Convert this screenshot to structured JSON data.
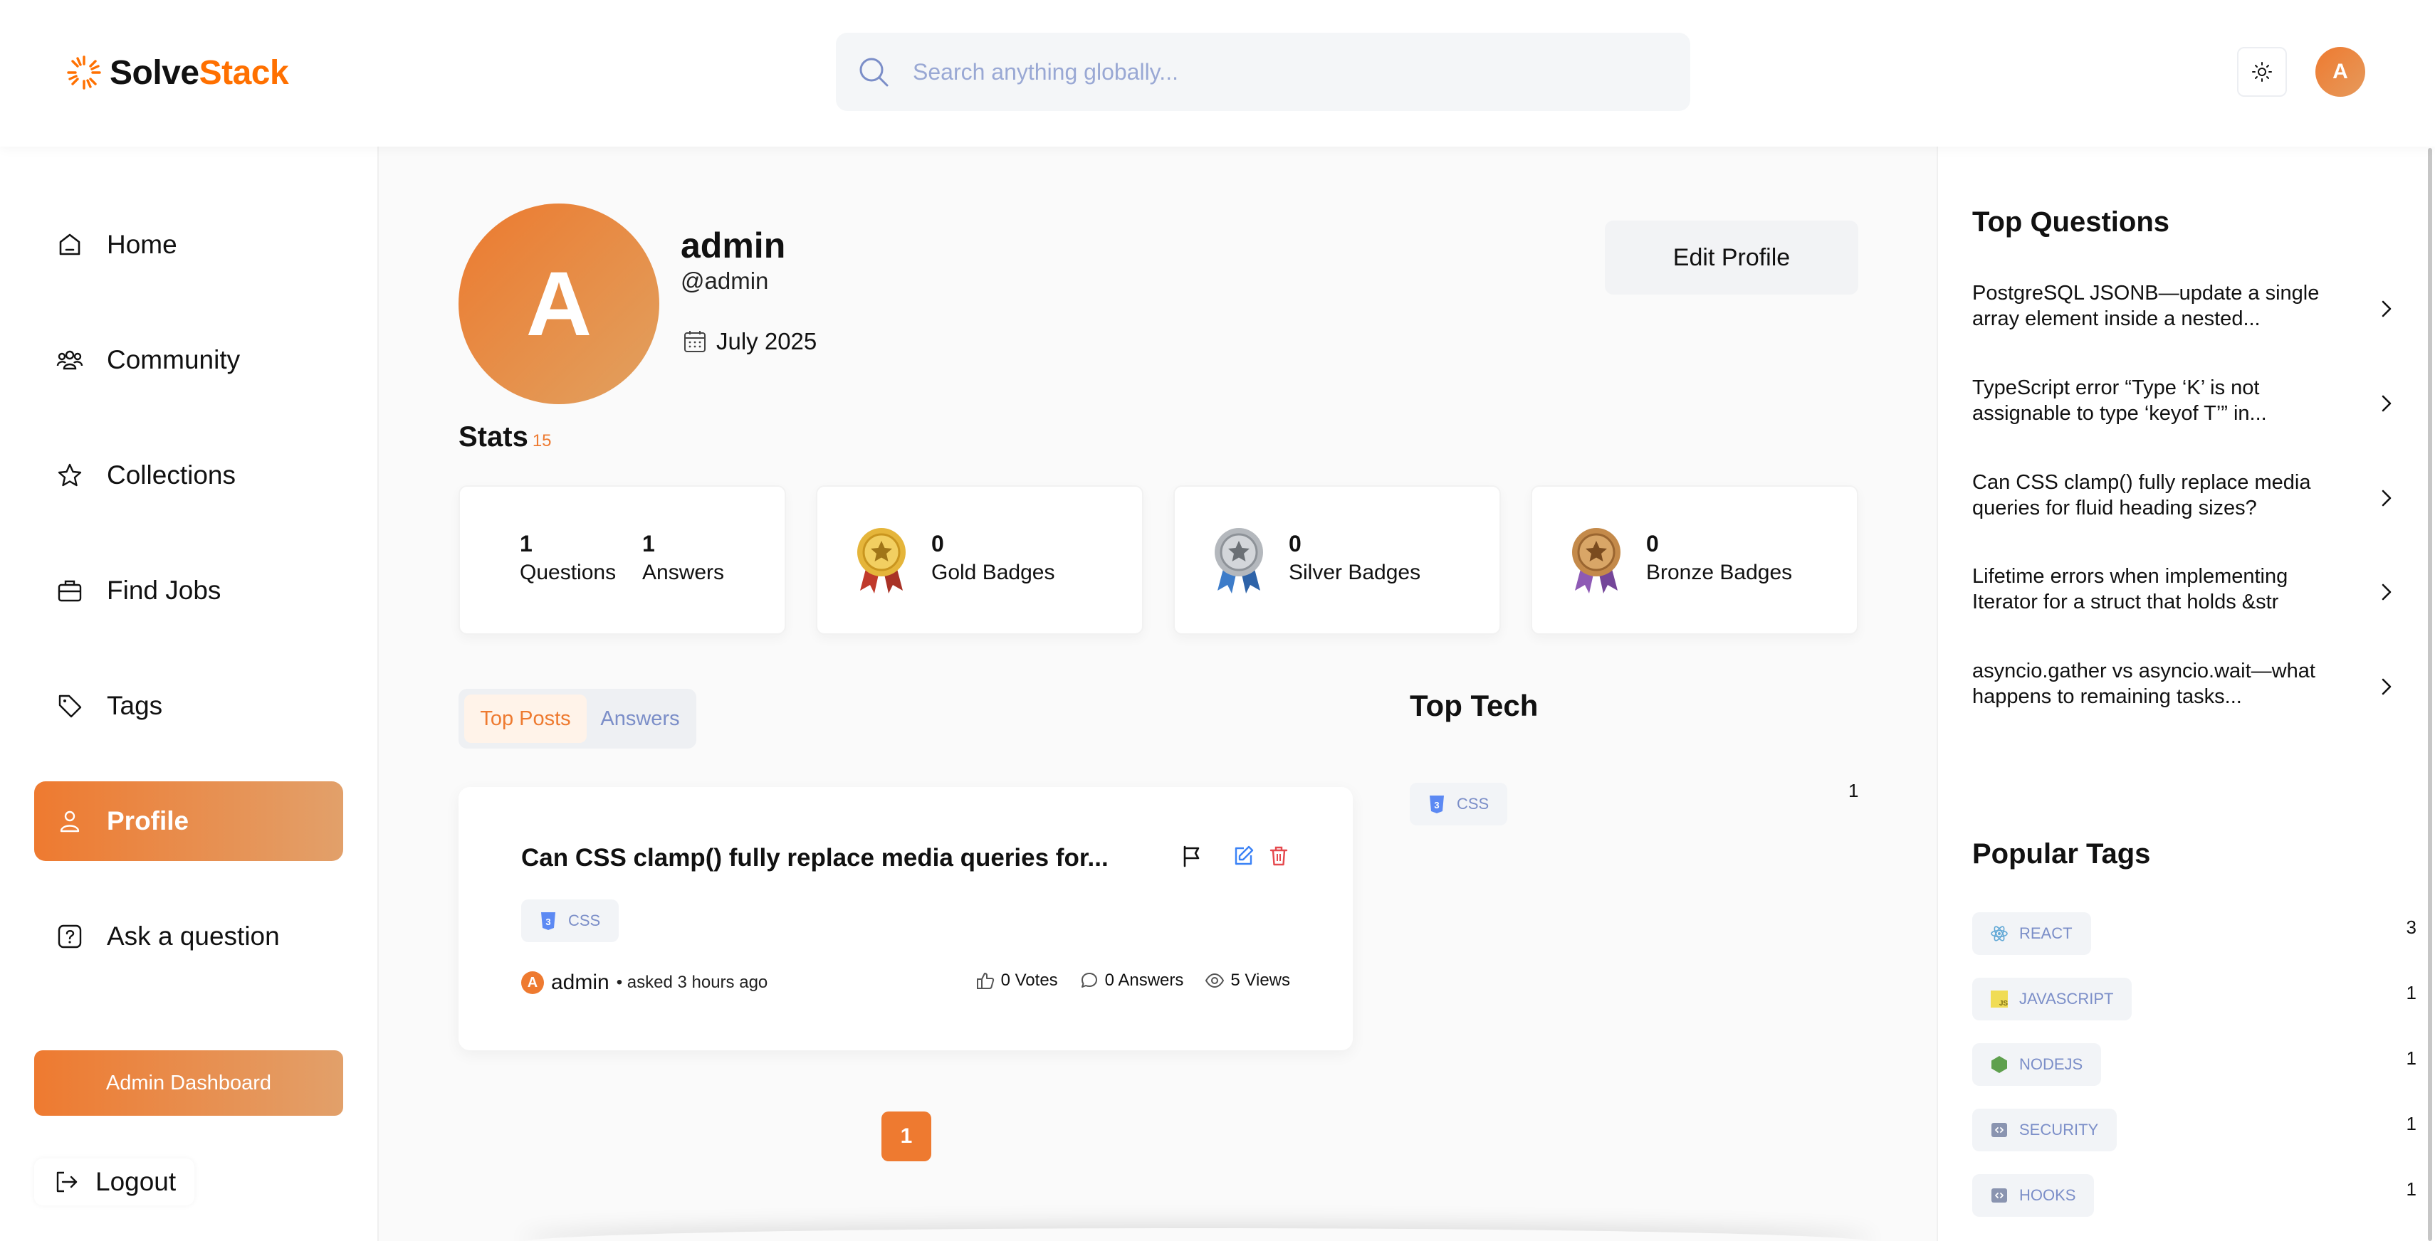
{
  "brand": {
    "name_part1": "Solve",
    "name_part2": "Stack",
    "accent": "#ff7000"
  },
  "search": {
    "placeholder": "Search anything globally..."
  },
  "header": {
    "avatar_initial": "A"
  },
  "sidebar": {
    "items": [
      {
        "label": "Home",
        "icon": "home-icon"
      },
      {
        "label": "Community",
        "icon": "users-icon"
      },
      {
        "label": "Collections",
        "icon": "star-icon"
      },
      {
        "label": "Find Jobs",
        "icon": "briefcase-icon"
      },
      {
        "label": "Tags",
        "icon": "tag-icon"
      },
      {
        "label": "Profile",
        "icon": "user-icon",
        "active": true
      },
      {
        "label": "Ask a question",
        "icon": "question-icon"
      }
    ],
    "admin_button": "Admin Dashboard",
    "logout": "Logout"
  },
  "profile": {
    "initial": "A",
    "name": "admin",
    "username": "@admin",
    "joined": "July 2025",
    "edit_button": "Edit Profile"
  },
  "stats": {
    "title": "Stats",
    "count": "15",
    "questions": {
      "value": "1",
      "label": "Questions"
    },
    "answers": {
      "value": "1",
      "label": "Answers"
    },
    "gold": {
      "value": "0",
      "label": "Gold Badges"
    },
    "silver": {
      "value": "0",
      "label": "Silver Badges"
    },
    "bronze": {
      "value": "0",
      "label": "Bronze Badges"
    }
  },
  "tabs": {
    "top_posts": "Top Posts",
    "answers": "Answers"
  },
  "post": {
    "title": "Can CSS clamp() fully replace media queries for...",
    "tag": "css",
    "author": "admin",
    "author_initial": "A",
    "asked": "• asked 3 hours ago",
    "votes": "0 Votes",
    "answers": "0 Answers",
    "views": "5 Views"
  },
  "pagination": {
    "current": "1"
  },
  "top_tech": {
    "title": "Top Tech",
    "tag": "css",
    "count": "1"
  },
  "right_sidebar": {
    "top_questions_title": "Top Questions",
    "top_questions": [
      "PostgreSQL JSONB—update a single array element inside a nested...",
      "TypeScript error “Type ‘K’ is not assignable to type ‘keyof T’” in...",
      "Can CSS clamp() fully replace media queries for fluid heading sizes?",
      "Lifetime errors when implementing Iterator for a struct that holds &str",
      "asyncio.gather vs asyncio.wait—what happens to remaining tasks..."
    ],
    "popular_tags_title": "Popular Tags",
    "popular_tags": [
      {
        "name": "react",
        "count": "3",
        "icon": "react-icon"
      },
      {
        "name": "javascript",
        "count": "1",
        "icon": "javascript-icon"
      },
      {
        "name": "nodejs",
        "count": "1",
        "icon": "nodejs-icon"
      },
      {
        "name": "security",
        "count": "1",
        "icon": "security-icon"
      },
      {
        "name": "hooks",
        "count": "1",
        "icon": "hooks-icon"
      }
    ]
  }
}
